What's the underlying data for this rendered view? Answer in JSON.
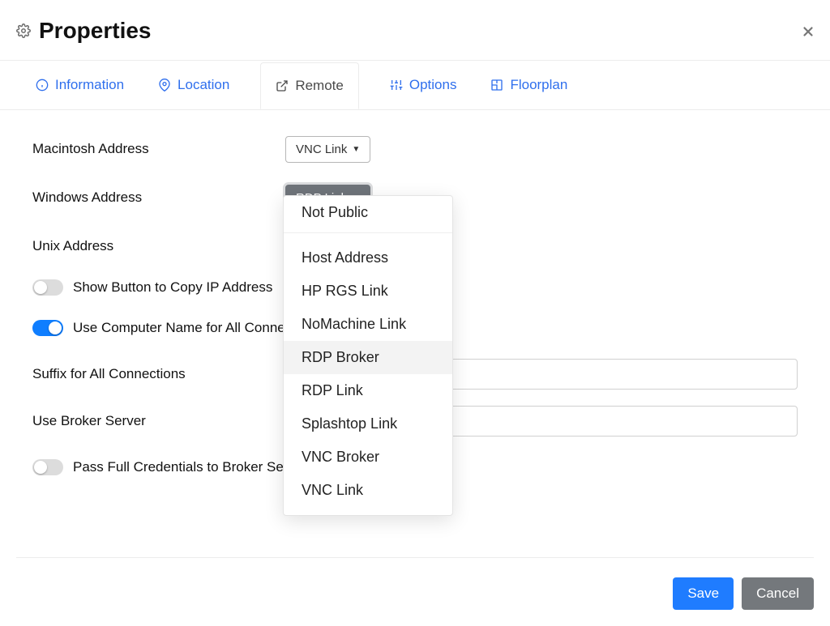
{
  "title": "Properties",
  "tabs": {
    "information": "Information",
    "location": "Location",
    "remote": "Remote",
    "options": "Options",
    "floorplan": "Floorplan"
  },
  "labels": {
    "mac": "Macintosh Address",
    "win": "Windows Address",
    "unix": "Unix Address",
    "show_copy": "Show Button to Copy IP Address",
    "use_name": "Use Computer Name for All Connections",
    "suffix": "Suffix for All Connections",
    "broker": "Use Broker Server",
    "pass_creds": "Pass Full Credentials to Broker Server (RGS only)"
  },
  "dropdowns": {
    "mac_value": "VNC Link",
    "win_value": "RDP Link"
  },
  "menu": {
    "not_public": "Not Public",
    "host_address": "Host Address",
    "hp_rgs": "HP RGS Link",
    "nomachine": "NoMachine Link",
    "rdp_broker": "RDP Broker",
    "rdp_link": "RDP Link",
    "splashtop": "Splashtop Link",
    "vnc_broker": "VNC Broker",
    "vnc_link": "VNC Link"
  },
  "inputs": {
    "suffix_value": "",
    "broker_value": ""
  },
  "toggles": {
    "show_copy": false,
    "use_name": true,
    "pass_creds": false
  },
  "buttons": {
    "save": "Save",
    "cancel": "Cancel"
  }
}
